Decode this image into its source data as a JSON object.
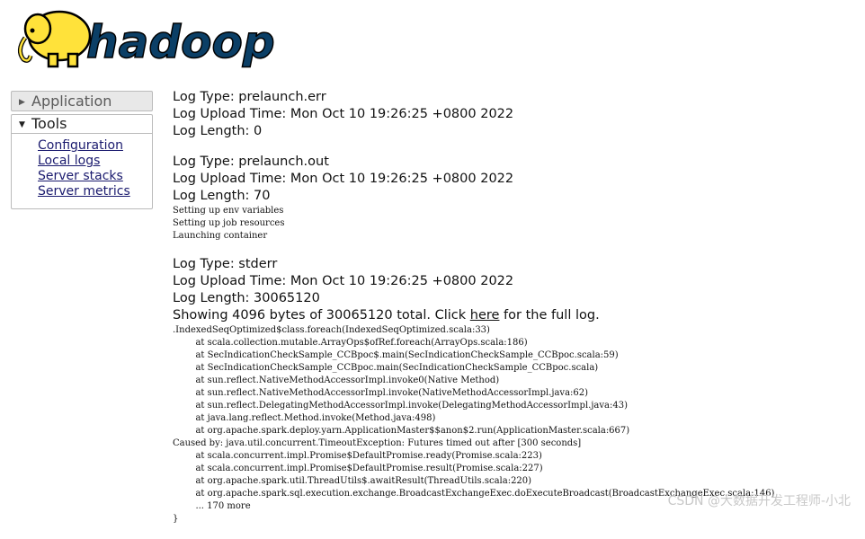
{
  "brand": {
    "name": "hadoop",
    "logo_colors": {
      "elephant": "#ffe23a",
      "text": "#0b3f66",
      "outline": "#000000"
    }
  },
  "sidebar": {
    "application_label": "Application",
    "tools_label": "Tools",
    "tools_items": [
      {
        "label": "Configuration"
      },
      {
        "label": "Local logs"
      },
      {
        "label": "Server stacks"
      },
      {
        "label": "Server metrics"
      }
    ]
  },
  "logs": [
    {
      "type": "Log Type: prelaunch.err",
      "upload": "Log Upload Time: Mon Oct 10 19:26:25 +0800 2022",
      "length": "Log Length: 0",
      "body": ""
    },
    {
      "type": "Log Type: prelaunch.out",
      "upload": "Log Upload Time: Mon Oct 10 19:26:25 +0800 2022",
      "length": "Log Length: 70",
      "body": "Setting up env variables\nSetting up job resources\nLaunching container"
    },
    {
      "type": "Log Type: stderr",
      "upload": "Log Upload Time: Mon Oct 10 19:26:25 +0800 2022",
      "length": "Log Length: 30065120",
      "showing_prefix": "Showing 4096 bytes of 30065120 total. Click ",
      "showing_link": "here",
      "showing_suffix": " for the full log.",
      "body": ".IndexedSeqOptimized$class.foreach(IndexedSeqOptimized.scala:33)\n\tat scala.collection.mutable.ArrayOps$ofRef.foreach(ArrayOps.scala:186)\n\tat SecIndicationCheckSample_CCBpoc$.main(SecIndicationCheckSample_CCBpoc.scala:59)\n\tat SecIndicationCheckSample_CCBpoc.main(SecIndicationCheckSample_CCBpoc.scala)\n\tat sun.reflect.NativeMethodAccessorImpl.invoke0(Native Method)\n\tat sun.reflect.NativeMethodAccessorImpl.invoke(NativeMethodAccessorImpl.java:62)\n\tat sun.reflect.DelegatingMethodAccessorImpl.invoke(DelegatingMethodAccessorImpl.java:43)\n\tat java.lang.reflect.Method.invoke(Method.java:498)\n\tat org.apache.spark.deploy.yarn.ApplicationMaster$$anon$2.run(ApplicationMaster.scala:667)\nCaused by: java.util.concurrent.TimeoutException: Futures timed out after [300 seconds]\n\tat scala.concurrent.impl.Promise$DefaultPromise.ready(Promise.scala:223)\n\tat scala.concurrent.impl.Promise$DefaultPromise.result(Promise.scala:227)\n\tat org.apache.spark.util.ThreadUtils$.awaitResult(ThreadUtils.scala:220)\n\tat org.apache.spark.sql.execution.exchange.BroadcastExchangeExec.doExecuteBroadcast(BroadcastExchangeExec.scala:146)\n\t... 170 more\n}"
    }
  ],
  "watermark": "CSDN @大数据开发工程师-小北"
}
